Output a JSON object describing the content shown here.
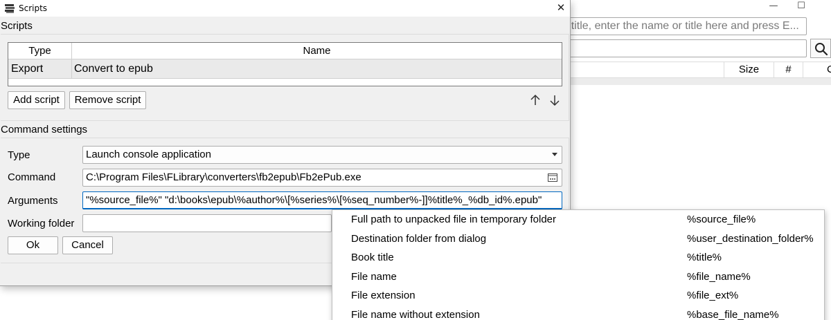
{
  "background_window": {
    "search_placeholder": "r title, enter the name or title here and press E...",
    "minimize_glyph": "—",
    "maximize_glyph": "☐",
    "columns": [
      "Size",
      "#",
      "C"
    ]
  },
  "dialog": {
    "title": "Scripts",
    "close_glyph": "✕",
    "scripts_group_title": "Scripts",
    "table": {
      "headers": {
        "type": "Type",
        "name": "Name"
      },
      "rows": [
        {
          "type": "Export",
          "name": "Convert to epub"
        }
      ]
    },
    "buttons": {
      "add_script": "Add script",
      "remove_script": "Remove script",
      "move_up": "↑",
      "move_down": "↓",
      "ok": "Ok",
      "cancel": "Cancel"
    },
    "command_group_title": "Command settings",
    "labels": {
      "type": "Type",
      "command": "Command",
      "arguments": "Arguments",
      "working_folder": "Working folder"
    },
    "fields": {
      "type_value": "Launch console application",
      "command_value": "C:\\Program Files\\FLibrary\\converters\\fb2epub\\Fb2ePub.exe",
      "arguments_value": "\"%source_file%\" \"d:\\books\\epub\\%author%\\[%series%\\[%seq_number%-]]%title%_%db_id%.epub\"",
      "working_folder_value": ""
    }
  },
  "popup_menu": {
    "items": [
      {
        "description": "Full path to unpacked file in temporary folder",
        "variable": "%source_file%"
      },
      {
        "description": "Destination folder from dialog",
        "variable": "%user_destination_folder%"
      },
      {
        "description": "Book title",
        "variable": "%title%"
      },
      {
        "description": "File name",
        "variable": "%file_name%"
      },
      {
        "description": "File extension",
        "variable": "%file_ext%"
      },
      {
        "description": "File name without extension",
        "variable": "%base_file_name%"
      }
    ]
  },
  "colors": {
    "dialog_bg": "#f0f0f0",
    "focus_accent": "#0067c0",
    "selected_row": "#eaeaea"
  }
}
